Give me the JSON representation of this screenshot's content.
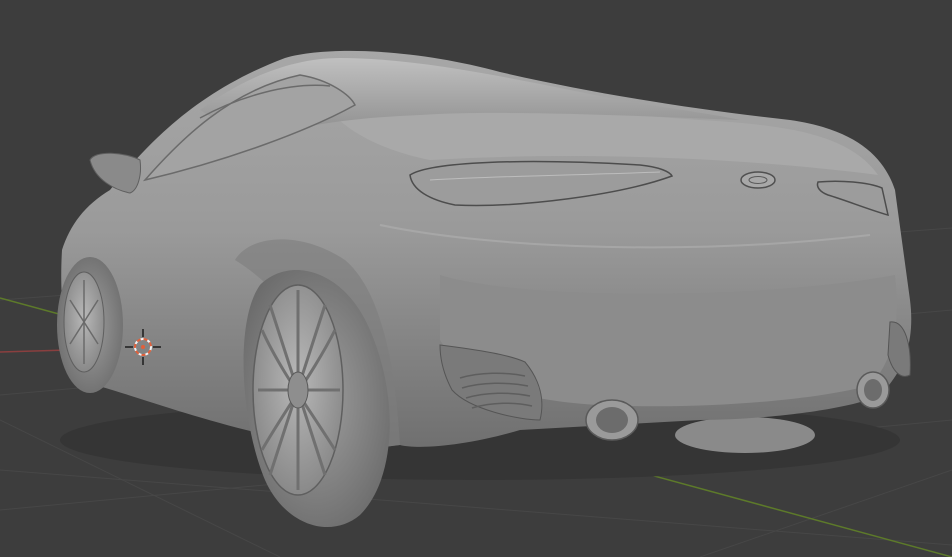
{
  "viewport": {
    "background": "#3d3d3d",
    "grid_line_color": "#474747",
    "x_axis_color": "#8a3f3f",
    "y_axis_color": "#5d7a2a"
  },
  "object": {
    "name": "car-model",
    "body_color": "#8f8f8f",
    "highlight_color": "#b5b5b5",
    "shadow_color": "#5a5a5a"
  },
  "origin_marker": {
    "icon": "3d-cursor-icon",
    "ring_color_a": "#e0603b",
    "ring_color_b": "#f2f2f2"
  }
}
